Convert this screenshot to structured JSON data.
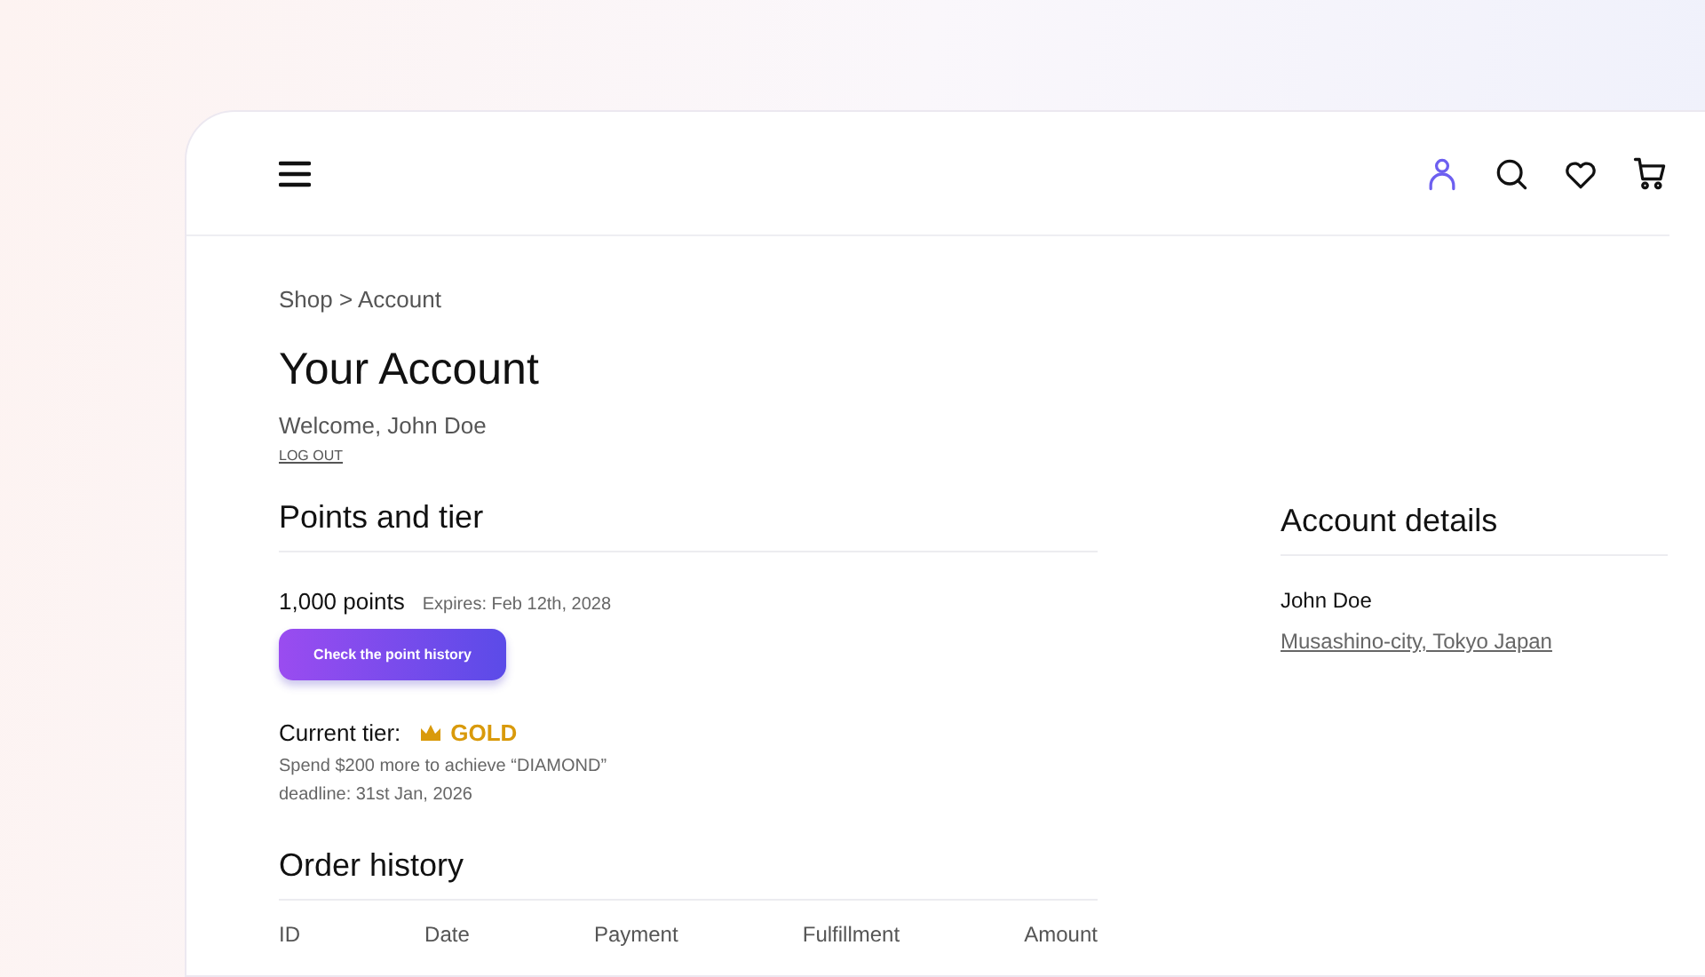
{
  "header": {
    "icons": [
      {
        "kind": "account",
        "selected": true
      },
      {
        "kind": "search",
        "selected": false
      },
      {
        "kind": "favorites",
        "selected": false
      },
      {
        "kind": "cart",
        "selected": false
      }
    ]
  },
  "breadcrumb": "Shop > Account",
  "title": "Your Account",
  "welcome": "Welcome, John Doe",
  "logout": "LOG OUT",
  "points": {
    "heading": "Points and tier",
    "amount": "1,000 points",
    "expires": "Expires: Feb 12th, 2028",
    "button": "Check the point history",
    "tier_label": "Current tier:",
    "tier": "GOLD",
    "progress": "Spend $200 more to achieve “DIAMOND”",
    "deadline": "deadline: 31st Jan, 2026"
  },
  "orders": {
    "heading": "Order history",
    "columns": [
      "ID",
      "Date",
      "Payment",
      "Fulfillment",
      "Amount"
    ]
  },
  "account_details": {
    "heading": "Account details",
    "name": "John Doe",
    "address": "Musashino-city, Tokyo Japan"
  }
}
